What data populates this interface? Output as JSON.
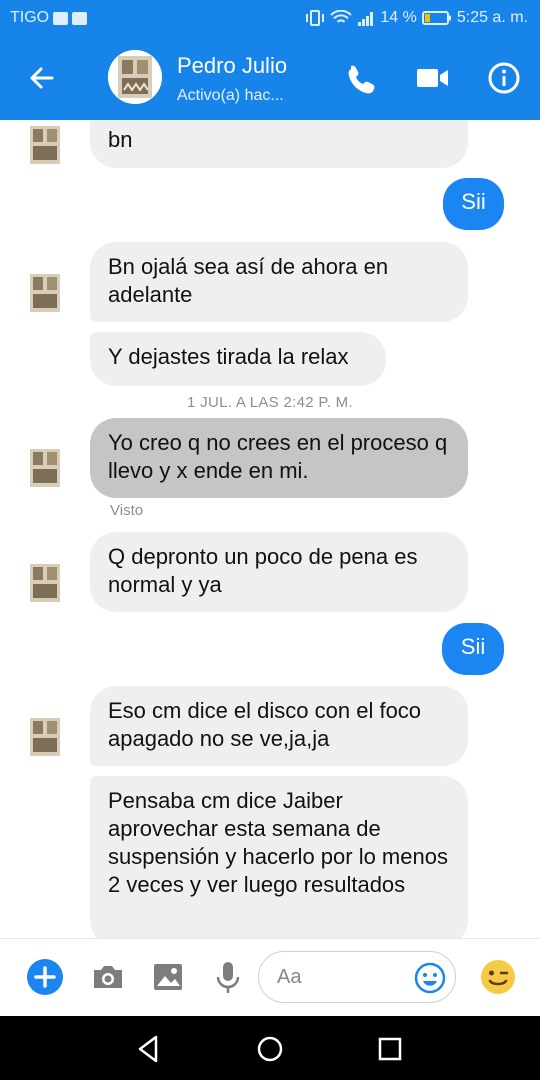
{
  "status_bar": {
    "carrier": "TIGO",
    "battery": "14 %",
    "time": "5:25 a. m."
  },
  "header": {
    "contact_name": "Pedro Julio",
    "contact_status": "Activo(a) hac..."
  },
  "messages": [
    {
      "text": "bn"
    },
    {
      "text": "Sii"
    },
    {
      "text": "Bn ojalá sea así de ahora en adelante"
    },
    {
      "text": "Y dejastes tirada la relax"
    },
    {
      "text": "Yo creo q no crees en el proceso q llevo y x ende en mi."
    },
    {
      "text": "Q depronto un poco de pena es normal y ya"
    },
    {
      "text": "Sii"
    },
    {
      "text": "Eso cm dice el disco con el foco apagado no se ve,ja,ja"
    },
    {
      "text": "Pensaba cm dice Jaiber aprovechar esta semana de suspensión y hacerlo por lo menos 2 veces y ver luego resultados"
    }
  ],
  "time_divider": "1 JUL. A LAS 2:42 P. M.",
  "seen_label": "Visto",
  "composer": {
    "placeholder": "Aa"
  },
  "colors": {
    "brand": "#1784ea",
    "outgoing_bubble": "#1b85f2",
    "incoming_bubble": "#efefef",
    "selected_bubble": "#c5c5c5",
    "emoji_yellow": "#f7c948"
  },
  "icons": {
    "back": "arrow-left-icon",
    "call": "phone-icon",
    "video": "video-camera-icon",
    "info": "info-icon",
    "add": "plus-circle-icon",
    "camera": "camera-icon",
    "gallery": "image-icon",
    "mic": "microphone-icon",
    "emoji_picker": "smiley-icon",
    "wink": "wink-emoji-icon"
  }
}
